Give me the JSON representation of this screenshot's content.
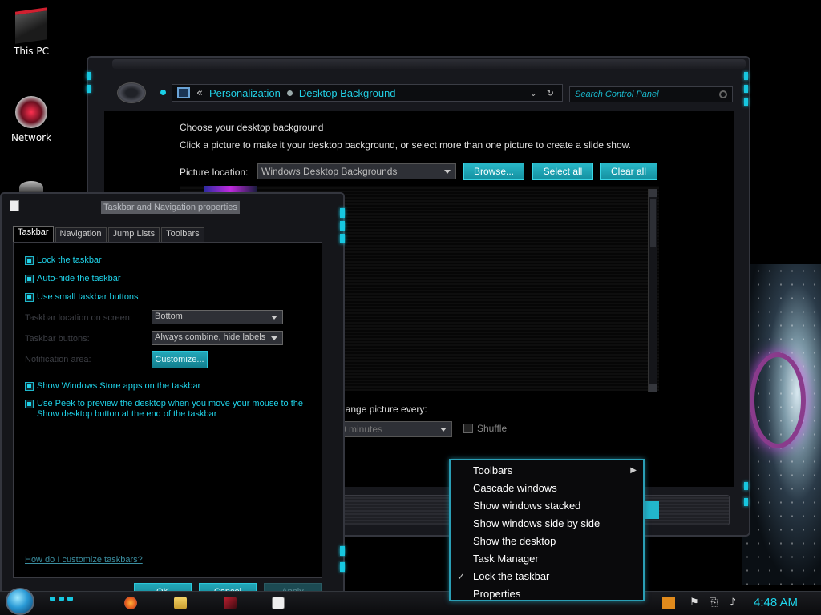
{
  "desktop": {
    "icons": [
      {
        "label": "This PC"
      },
      {
        "label": "Network"
      }
    ]
  },
  "control_panel": {
    "breadcrumb": [
      "Personalization",
      "Desktop Background"
    ],
    "breadcrumb_separator": "«",
    "search_placeholder": "Search Control Panel",
    "heading": "Choose your desktop background",
    "instructions": "Click a picture to make it your desktop background, or select more than one picture to create a slide show.",
    "picture_location_label": "Picture location:",
    "picture_location_value": "Windows Desktop Backgrounds",
    "browse_button": "Browse...",
    "select_all_button": "Select all",
    "clear_all_button": "Clear all",
    "change_picture_label": "hange picture every:",
    "interval_value": "0 minutes",
    "shuffle_label": "Shuffle"
  },
  "taskbar_dialog": {
    "title": "Taskbar and Navigation properties",
    "tabs": [
      "Taskbar",
      "Navigation",
      "Jump Lists",
      "Toolbars"
    ],
    "active_tab": "Taskbar",
    "options": {
      "lock_taskbar": "Lock the taskbar",
      "auto_hide": "Auto-hide the taskbar",
      "small_buttons": "Use small taskbar buttons",
      "store_apps": "Show Windows Store apps on the taskbar",
      "peek_line1": "Use Peek to preview the desktop when you move your mouse to the",
      "peek_line2": "Show desktop button at the end of the taskbar"
    },
    "location_label": "Taskbar location on screen:",
    "location_value": "Bottom",
    "buttons_label": "Taskbar buttons:",
    "buttons_value": "Always combine, hide labels",
    "notification_label": "Notification area:",
    "customize_button": "Customize...",
    "help_link": "How do I customize taskbars?",
    "ok_button": "OK",
    "cancel_button": "Cancel",
    "apply_button": "Apply"
  },
  "context_menu": {
    "items": [
      {
        "label": "Toolbars",
        "submenu": true
      },
      {
        "label": "Cascade windows"
      },
      {
        "label": "Show windows stacked"
      },
      {
        "label": "Show windows side by side"
      },
      {
        "label": "Show the desktop"
      },
      {
        "label": "Task Manager"
      },
      {
        "label": "Lock the taskbar",
        "checked": true
      },
      {
        "label": "Properties"
      }
    ],
    "check_glyph": "✓",
    "submenu_glyph": "▶"
  },
  "taskbar": {
    "clock": "4:48 AM",
    "accent_color": "#17c7e0"
  }
}
